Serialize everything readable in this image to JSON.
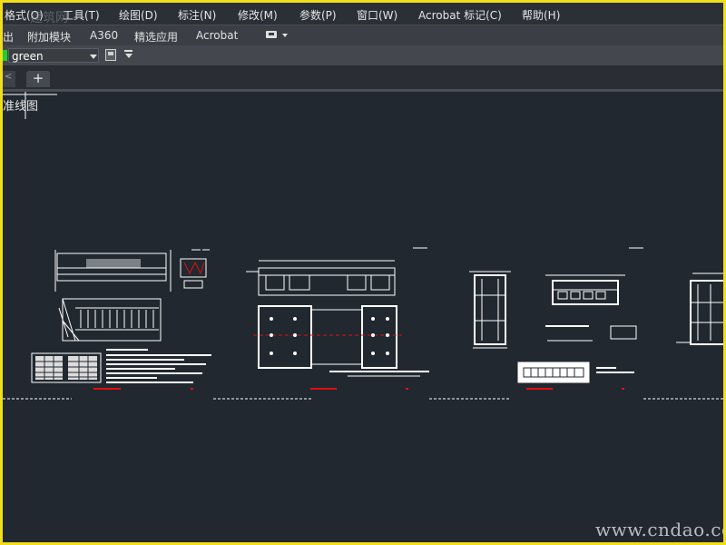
{
  "menubar": {
    "items": [
      "格式(O)",
      "工具(T)",
      "绘图(D)",
      "标注(N)",
      "修改(M)",
      "参数(P)",
      "窗口(W)",
      "Acrobat 标记(C)",
      "帮助(H)"
    ]
  },
  "ribbon": {
    "tabs": [
      "出",
      "附加模块",
      "A360",
      "精选应用",
      "Acrobat"
    ]
  },
  "layer": {
    "name": "green",
    "color": "#1fd12a"
  },
  "tabs": {
    "add_label": "+",
    "partial_label": "<"
  },
  "viewport": {
    "label": "准线图",
    "background": "#212830"
  },
  "watermark": {
    "text": "www.cndao.com",
    "top_text": "建筑网"
  },
  "colors": {
    "frame": "#f3de1a",
    "red_marks": "#e01010"
  }
}
